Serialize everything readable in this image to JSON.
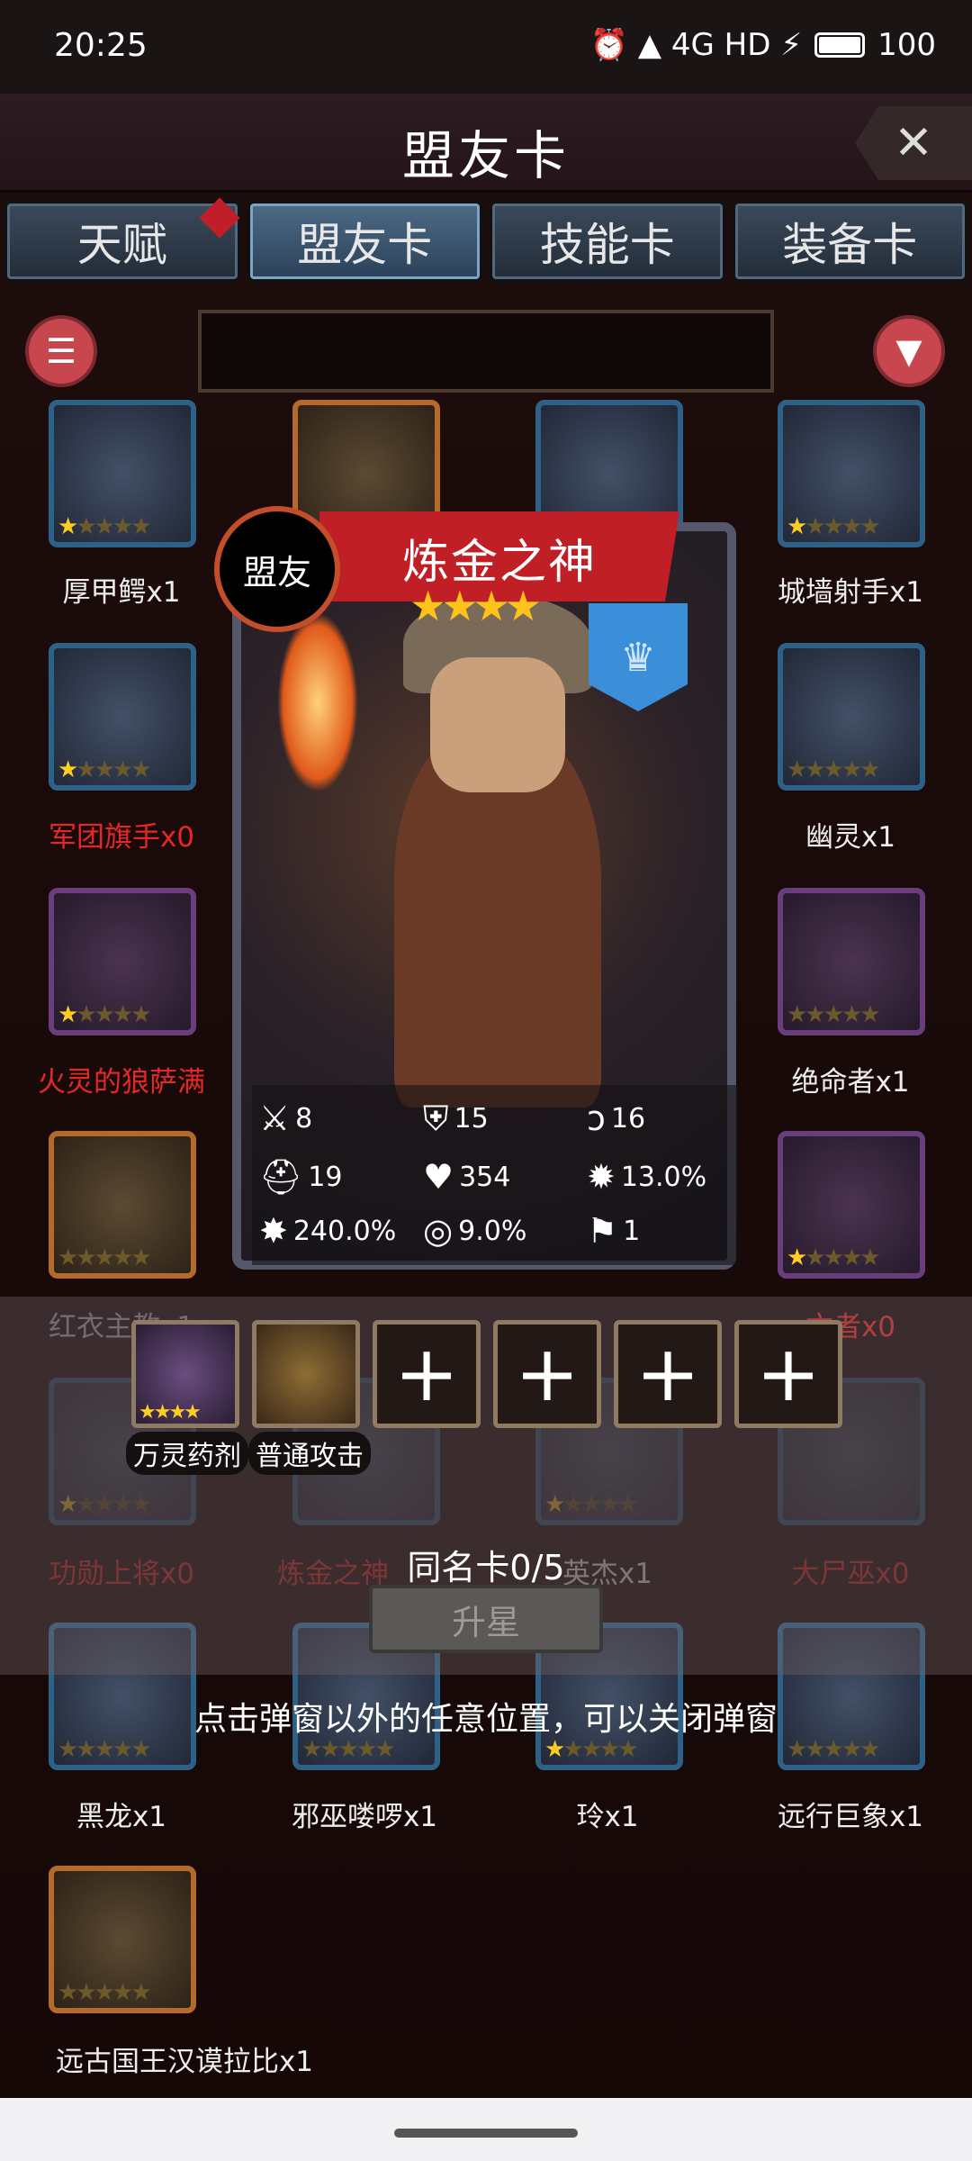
{
  "status_bar": {
    "time": "20:25",
    "indicators": "⏰ ▲ 4G HD ⚡",
    "battery": "100"
  },
  "header": {
    "title": "盟友卡",
    "close_label": "✕"
  },
  "tabs": [
    {
      "label": "天赋",
      "has_notification": true
    },
    {
      "label": "盟友卡",
      "active": true
    },
    {
      "label": "技能卡"
    },
    {
      "label": "装备卡"
    }
  ],
  "toolbar": {
    "menu_icon": "list-icon",
    "filter_icon": "filter-icon",
    "search_value": ""
  },
  "grid_cards": [
    {
      "label": "厚甲鳄x1",
      "stars": 1
    },
    {
      "label": "城墙射手x1",
      "stars": 1
    },
    {
      "label": "军团旗手x0",
      "stars": 1
    },
    {
      "label": "幽灵x1",
      "stars": 0
    },
    {
      "label": "火灵的狼萨满",
      "stars": 1
    },
    {
      "label": "绝命者x1",
      "stars": 0
    },
    {
      "label": "红衣主教x1",
      "stars": 0
    },
    {
      "label": "亡者x0",
      "stars": 1
    },
    {
      "label": "功勋上将x0",
      "stars": 1
    },
    {
      "label": "炼金之神",
      "stars": 0
    },
    {
      "label": "英杰x1",
      "stars": 1
    },
    {
      "label": "大尸巫x0",
      "stars": 0
    },
    {
      "label": "黑龙x1",
      "stars": 0
    },
    {
      "label": "邪巫喽啰x1",
      "stars": 0
    },
    {
      "label": "玲x1",
      "stars": 1
    },
    {
      "label": "远行巨象x1",
      "stars": 0
    },
    {
      "label": "远古国王汉谟拉比x1",
      "stars": 0
    }
  ],
  "detail_card": {
    "badge": "盟友",
    "name": "炼金之神",
    "stars": "★★★★",
    "stats": {
      "attack": "8",
      "defense": "15",
      "speed": "16",
      "health_regen": "19",
      "hp": "354",
      "crit": "13.0%",
      "crit_damage": "240.0%",
      "dodge": "9.0%",
      "move": "1"
    }
  },
  "skill_slots": [
    {
      "label": "万灵药剂",
      "stars": "★★★★"
    },
    {
      "label": "普通攻击",
      "stars": ""
    }
  ],
  "empty_slot_symbol": "+",
  "same_name_cards": "同名卡0/5",
  "upgrade_button": "升星",
  "close_hint": "点击弹窗以外的任意位置，可以关闭弹窗"
}
